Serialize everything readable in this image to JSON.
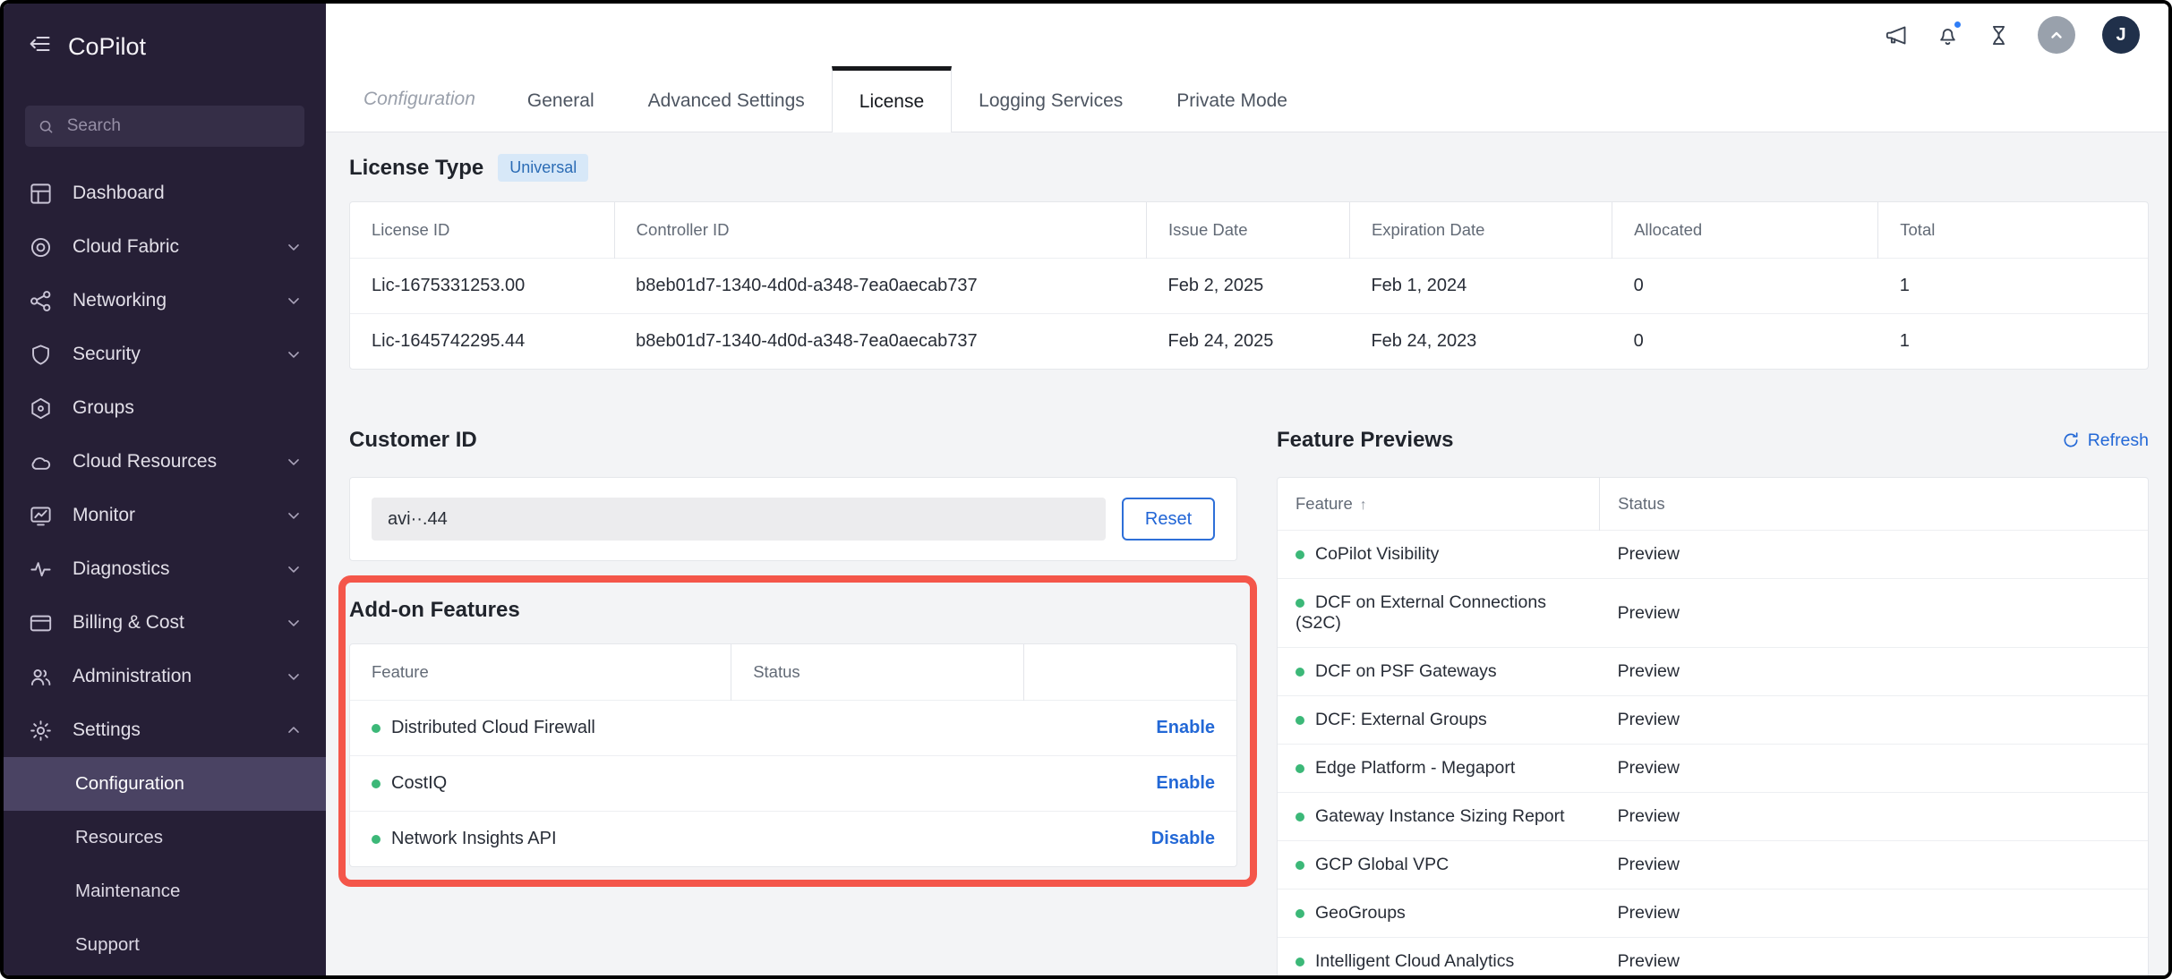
{
  "sidebar": {
    "title": "CoPilot",
    "search_placeholder": "Search",
    "items": [
      {
        "label": "Dashboard",
        "icon": "dashboard-icon",
        "chevron": "none"
      },
      {
        "label": "Cloud Fabric",
        "icon": "cloud-fabric-icon",
        "chevron": "down"
      },
      {
        "label": "Networking",
        "icon": "networking-icon",
        "chevron": "down"
      },
      {
        "label": "Security",
        "icon": "security-icon",
        "chevron": "down"
      },
      {
        "label": "Groups",
        "icon": "groups-icon",
        "chevron": "none"
      },
      {
        "label": "Cloud Resources",
        "icon": "cloud-resources-icon",
        "chevron": "down"
      },
      {
        "label": "Monitor",
        "icon": "monitor-icon",
        "chevron": "down"
      },
      {
        "label": "Diagnostics",
        "icon": "diagnostics-icon",
        "chevron": "down"
      },
      {
        "label": "Billing & Cost",
        "icon": "billing-icon",
        "chevron": "down"
      },
      {
        "label": "Administration",
        "icon": "administration-icon",
        "chevron": "down"
      },
      {
        "label": "Settings",
        "icon": "settings-icon",
        "chevron": "up"
      }
    ],
    "sub_items": [
      {
        "label": "Configuration",
        "active": true
      },
      {
        "label": "Resources",
        "active": false
      },
      {
        "label": "Maintenance",
        "active": false
      },
      {
        "label": "Support",
        "active": false
      }
    ]
  },
  "topbar": {
    "icons": [
      "announcements-icon",
      "notifications-icon",
      "tasks-icon",
      "scroll-top-icon"
    ],
    "avatar_initial": "J",
    "notification_dot": true
  },
  "tabs": {
    "context_label": "Configuration",
    "items": [
      "General",
      "Advanced Settings",
      "License",
      "Logging Services",
      "Private Mode"
    ],
    "active": "License"
  },
  "license": {
    "title": "License Type",
    "badge": "Universal",
    "columns": [
      "License ID",
      "Controller ID",
      "Issue Date",
      "Expiration Date",
      "Allocated",
      "Total"
    ],
    "rows": [
      [
        "Lic-1675331253.00",
        "b8eb01d7-1340-4d0d-a348-7ea0aecab737",
        "Feb 2, 2025",
        "Feb 1, 2024",
        "0",
        "1"
      ],
      [
        "Lic-1645742295.44",
        "b8eb01d7-1340-4d0d-a348-7ea0aecab737",
        "Feb 24, 2025",
        "Feb 24, 2023",
        "0",
        "1"
      ]
    ]
  },
  "customer_id": {
    "title": "Customer ID",
    "value": "avi··.44",
    "reset_label": "Reset"
  },
  "addons": {
    "title": "Add-on Features",
    "columns": [
      "Feature",
      "Status"
    ],
    "rows": [
      {
        "feature": "Distributed Cloud Firewall",
        "action": "Enable"
      },
      {
        "feature": "CostIQ",
        "action": "Enable"
      },
      {
        "feature": "Network Insights API",
        "action": "Disable"
      }
    ]
  },
  "previews": {
    "title": "Feature Previews",
    "refresh_label": "Refresh",
    "columns": [
      "Feature",
      "Status"
    ],
    "sort_arrow": "↑",
    "rows": [
      {
        "name": "CoPilot Visibility",
        "status": "Preview"
      },
      {
        "name": "DCF on External Connections (S2C)",
        "status": "Preview"
      },
      {
        "name": "DCF on PSF Gateways",
        "status": "Preview"
      },
      {
        "name": "DCF: External Groups",
        "status": "Preview"
      },
      {
        "name": "Edge Platform - Megaport",
        "status": "Preview"
      },
      {
        "name": "Gateway Instance Sizing Report",
        "status": "Preview"
      },
      {
        "name": "GCP Global VPC",
        "status": "Preview"
      },
      {
        "name": "GeoGroups",
        "status": "Preview"
      },
      {
        "name": "Intelligent Cloud Analytics",
        "status": "Preview"
      }
    ]
  },
  "colors": {
    "accent_blue": "#2368d6",
    "green_dot": "#3cb878",
    "annotation_red": "#f4564a",
    "badge_bg": "#d7e8f8",
    "badge_text": "#2b6cb5",
    "sidebar_bg": "#261f36",
    "sidebar_active_bg": "#4a4363"
  }
}
